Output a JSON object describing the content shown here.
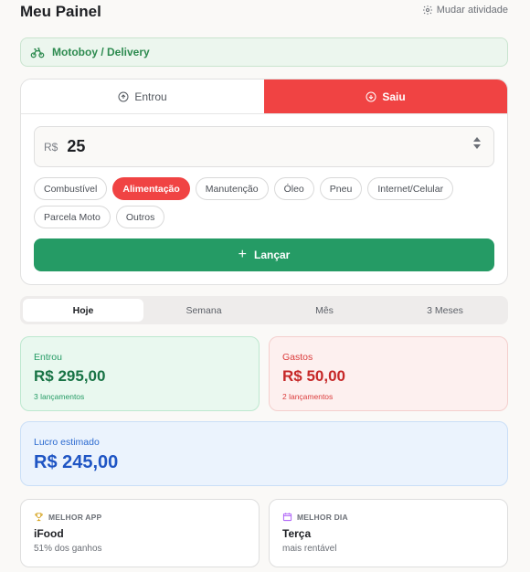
{
  "header": {
    "title": "Meu Painel",
    "switch_activity": "Mudar atividade"
  },
  "activity": {
    "label": "Motoboy / Delivery",
    "icon": "bicycle-icon"
  },
  "entry": {
    "toggle_in": "Entrou",
    "toggle_out": "Saiu",
    "selected": "Saiu",
    "currency": "R$",
    "amount": "25",
    "categories": [
      "Combustível",
      "Alimentação",
      "Manutenção",
      "Óleo",
      "Pneu",
      "Internet/Celular",
      "Parcela Moto",
      "Outros"
    ],
    "selected_category": "Alimentação",
    "submit_label": "Lançar"
  },
  "periods": {
    "tabs": [
      "Hoje",
      "Semana",
      "Mês",
      "3 Meses"
    ],
    "selected": "Hoje"
  },
  "stats": {
    "in": {
      "label": "Entrou",
      "value": "R$ 295,00",
      "count": "3 lançamentos"
    },
    "out": {
      "label": "Gastos",
      "value": "R$ 50,00",
      "count": "2 lançamentos"
    }
  },
  "profit": {
    "label": "Lucro estimado",
    "value": "R$ 245,00"
  },
  "insights": {
    "best_app": {
      "heading": "MELHOR APP",
      "title": "iFood",
      "sub": "51% dos ganhos"
    },
    "best_day": {
      "heading": "MELHOR DIA",
      "title": "Terça",
      "sub": "mais rentável"
    }
  },
  "colors": {
    "accent_red": "#f04343",
    "accent_green": "#259b65",
    "profit_blue": "#1f55c4",
    "activity_green": "#2e8b50"
  }
}
